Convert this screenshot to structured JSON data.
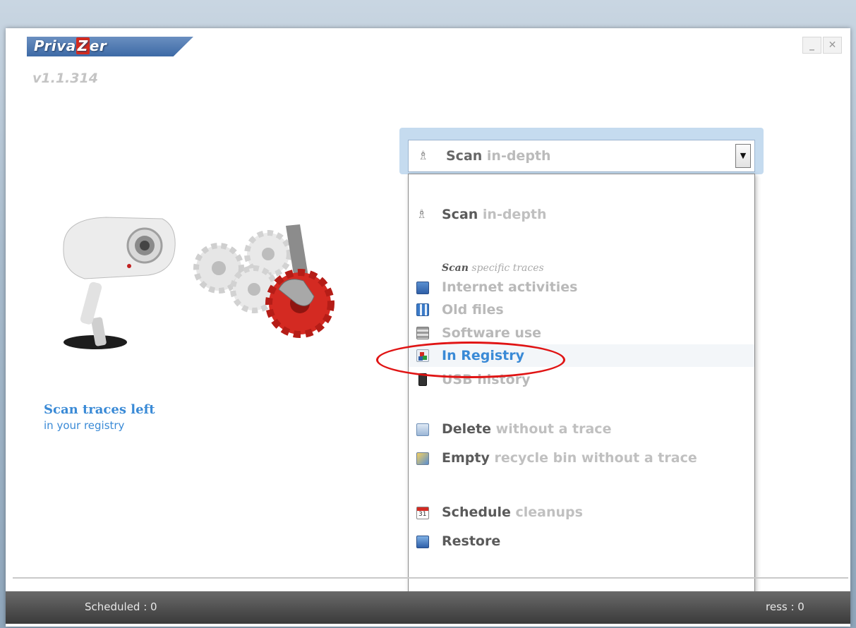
{
  "app": {
    "logo_text_a": "Priva",
    "logo_text_z": "Z",
    "logo_text_b": "er",
    "version": "v1.1.314",
    "minimize_icon": "minimize-icon",
    "close_icon": "close-icon"
  },
  "left_panel": {
    "title": "Scan traces left",
    "subtitle": "in your registry"
  },
  "combo": {
    "selected_bold": "Scan",
    "selected_light": " in-depth",
    "arrow_icon": "chevron-down-icon"
  },
  "menu": {
    "scan_in_depth_bold": "Scan",
    "scan_in_depth_light": " in-depth",
    "section_head_bold": "Scan",
    "section_head_light": " specific traces",
    "specific": [
      {
        "label": "Internet activities",
        "icon": "internet-icon",
        "highlight": false
      },
      {
        "label": "Old files",
        "icon": "old-files-icon",
        "highlight": false
      },
      {
        "label": "Software use",
        "icon": "software-icon",
        "highlight": false
      },
      {
        "label": "In Registry",
        "icon": "registry-icon",
        "highlight": true
      },
      {
        "label": "USB history",
        "icon": "usb-icon",
        "highlight": false
      }
    ],
    "delete_bold": "Delete",
    "delete_light": " without a trace",
    "empty_bold": "Empty",
    "empty_light": " recycle bin without a trace",
    "schedule_bold": "Schedule",
    "schedule_light": " cleanups",
    "restore": "Restore"
  },
  "status": {
    "scheduled": "Scheduled : 0",
    "progress": "ress : 0"
  },
  "colors": {
    "accent": "#3a8ad6",
    "highlight_oval": "#e01414",
    "logo_red": "#d52b1e"
  }
}
